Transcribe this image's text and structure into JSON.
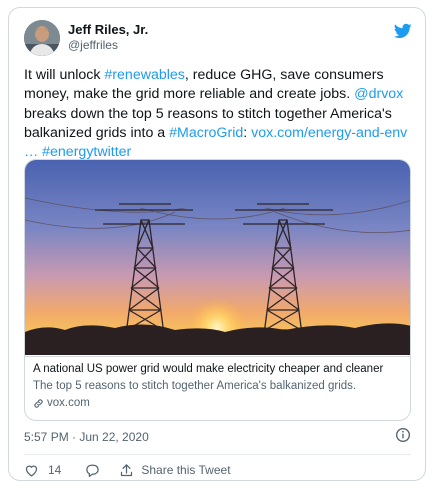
{
  "author": {
    "name": "Jeff Riles, Jr.",
    "handle": "@jeffriles"
  },
  "tweet": {
    "lines": [
      [
        {
          "t": "It will unlock ",
          "link": false
        },
        {
          "t": "#renewables",
          "link": true
        },
        {
          "t": ", reduce GHG, save consumers",
          "link": false
        }
      ],
      [
        {
          "t": "money, make the grid more reliable and create jobs. ",
          "link": false
        },
        {
          "t": "@drvox",
          "link": true
        }
      ],
      [
        {
          "t": "breaks down the top 5 reasons to stitch together America's",
          "link": false
        }
      ],
      [
        {
          "t": "balkanized grids into a ",
          "link": false
        },
        {
          "t": "#MacroGrid",
          "link": true
        },
        {
          "t": ": ",
          "link": false
        },
        {
          "t": "vox.com/energy-and-env",
          "link": true
        }
      ],
      [
        {
          "t": "… ",
          "link": true
        },
        {
          "t": "#energytwitter",
          "link": true
        }
      ]
    ]
  },
  "card": {
    "title": "A national US power grid would make electricity cheaper and cleaner",
    "description": "The top 5 reasons to stitch together America's balkanized grids.",
    "domain": "vox.com"
  },
  "timestamp": "5:57 PM · Jun 22, 2020",
  "actions": {
    "like_count": "14",
    "share_label": "Share this Tweet"
  },
  "colors": {
    "accent": "#1d9bf0",
    "text": "#0f1419",
    "secondary": "#536471",
    "border": "#cfd9de"
  },
  "icons": [
    "twitter-bird-icon",
    "link-icon",
    "info-icon",
    "heart-icon",
    "reply-icon",
    "share-icon"
  ]
}
